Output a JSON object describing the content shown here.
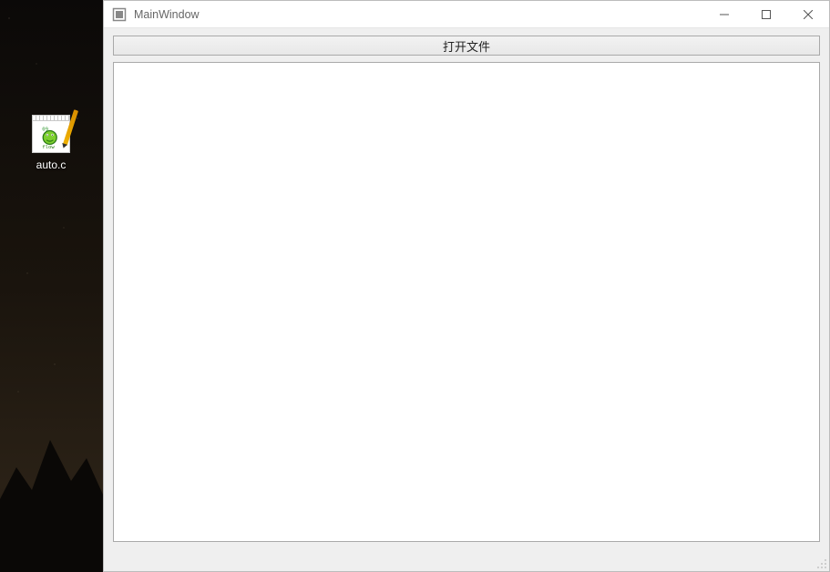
{
  "desktop": {
    "file": {
      "label": "auto.c",
      "icon_name": "c-source-file-icon"
    }
  },
  "window": {
    "title": "MainWindow",
    "controls": {
      "minimize": "minimize",
      "maximize": "maximize",
      "close": "close"
    },
    "open_button_label": "打开文件",
    "viewer_content": ""
  }
}
